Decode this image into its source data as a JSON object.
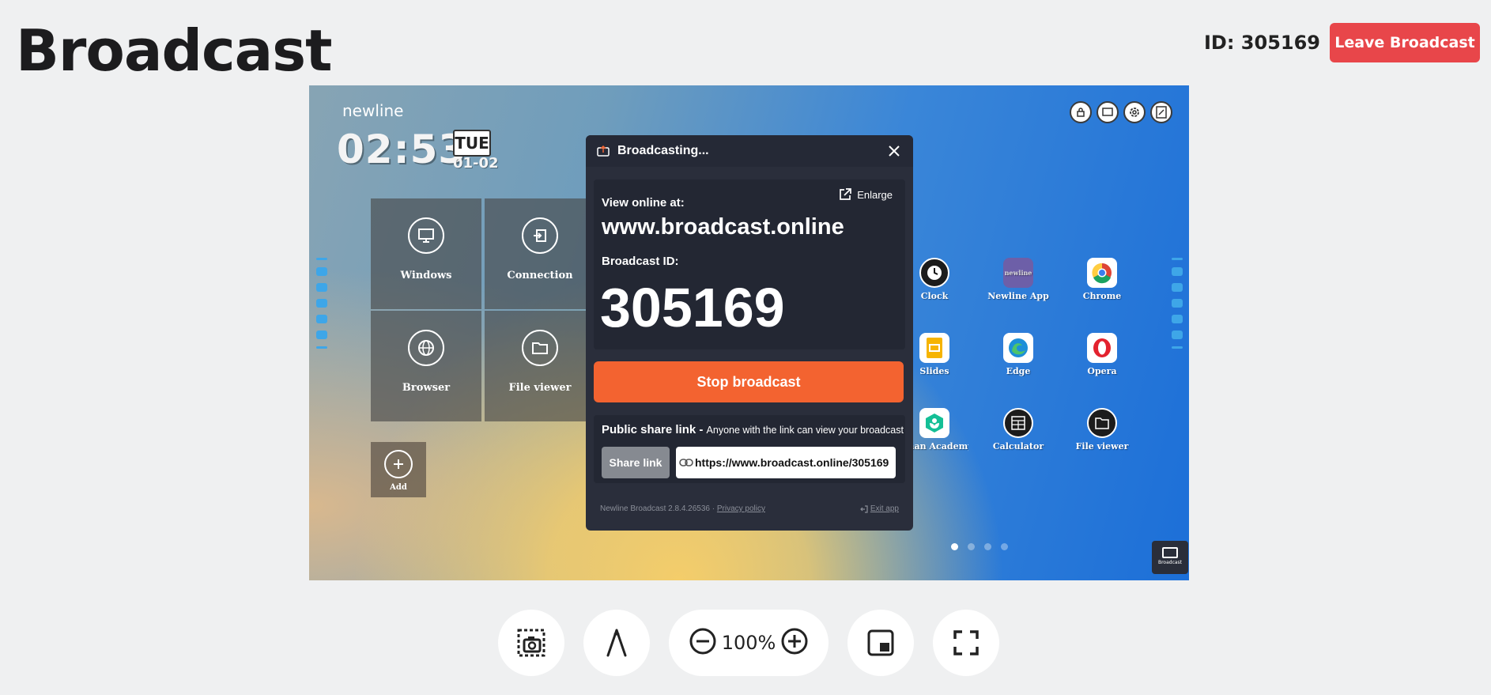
{
  "header": {
    "title": "Broadcast",
    "broadcast_id_label": "ID: 305169",
    "leave_button": "Leave Broadcast"
  },
  "colors": {
    "leave": "#e8464a",
    "stop": "#f36330",
    "panel_bg": "#2a2e3b",
    "page_bg": "#eff0f1"
  },
  "screen": {
    "logo": "newline",
    "time": "02:53",
    "day": "TUE",
    "date": "01-02",
    "tiles": [
      {
        "label": "Windows",
        "icon": "pc-icon"
      },
      {
        "label": "Connection",
        "icon": "input-icon"
      },
      {
        "label": "Browser",
        "icon": "globe-icon"
      },
      {
        "label": "File viewer",
        "icon": "folder-icon"
      }
    ],
    "add_label": "Add",
    "apps": [
      {
        "label": "Clock",
        "icon": "clock-icon"
      },
      {
        "label": "Newline App",
        "icon": "newline-app-icon"
      },
      {
        "label": "Chrome",
        "icon": "chrome-icon"
      },
      {
        "label": "Slides",
        "icon": "slides-icon"
      },
      {
        "label": "Edge",
        "icon": "edge-icon"
      },
      {
        "label": "Opera",
        "icon": "opera-icon"
      },
      {
        "label": "Khan Academy",
        "icon": "khan-academy-icon"
      },
      {
        "label": "Calculator",
        "icon": "calculator-icon"
      },
      {
        "label": "File viewer",
        "icon": "file-viewer-icon"
      }
    ],
    "mini_broadcast_label": "Broadcast"
  },
  "panel": {
    "title": "Broadcasting...",
    "enlarge": "Enlarge",
    "view_online_label": "View online at:",
    "url": "www.broadcast.online",
    "broadcast_id_label": "Broadcast ID:",
    "broadcast_id": "305169",
    "stop_button": "Stop broadcast",
    "share_title": "Public share link - ",
    "share_subtitle": "Anyone with the link can view your broadcast",
    "share_button": "Share link",
    "share_link": "https://www.broadcast.online/305169",
    "footer_version": "Newline Broadcast 2.8.4.26536 · ",
    "privacy": "Privacy policy",
    "exit": "Exit app"
  },
  "controls": {
    "zoom": "100%"
  }
}
